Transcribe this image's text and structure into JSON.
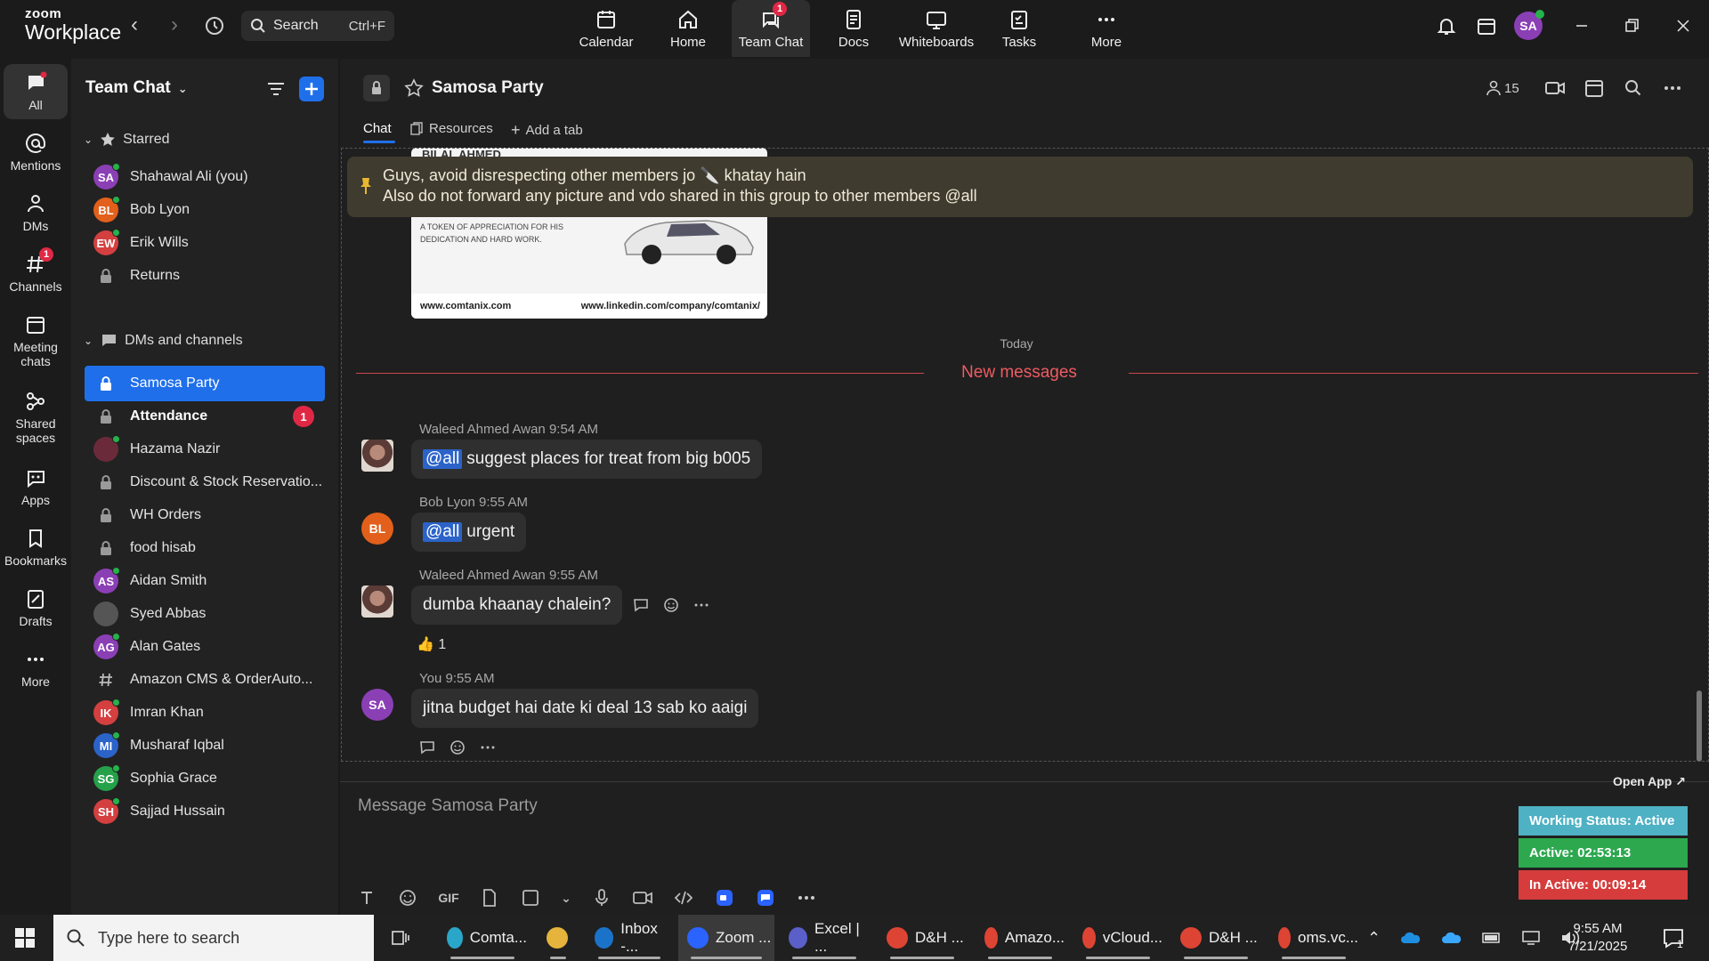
{
  "app": {
    "logo_top": "zoom",
    "logo_bottom": "Workplace"
  },
  "search": {
    "label": "Search",
    "shortcut": "Ctrl+F"
  },
  "topnav": [
    {
      "label": "Calendar",
      "icon": "calendar-icon"
    },
    {
      "label": "Home",
      "icon": "home-icon"
    },
    {
      "label": "Team Chat",
      "icon": "chat-icon",
      "badge": "1"
    },
    {
      "label": "Docs",
      "icon": "docs-icon"
    },
    {
      "label": "Whiteboards",
      "icon": "whiteboard-icon"
    },
    {
      "label": "Tasks",
      "icon": "tasks-icon"
    },
    {
      "label": "More",
      "icon": "more-icon"
    }
  ],
  "user": {
    "initials": "SA"
  },
  "rail": [
    {
      "label": "All"
    },
    {
      "label": "Mentions"
    },
    {
      "label": "DMs"
    },
    {
      "label": "Channels",
      "badge": "1"
    },
    {
      "label": "Meeting chats"
    },
    {
      "label": "Shared spaces"
    },
    {
      "label": "Apps"
    },
    {
      "label": "Bookmarks"
    },
    {
      "label": "Drafts"
    },
    {
      "label": "More"
    }
  ],
  "panel": {
    "title": "Team Chat",
    "starred_label": "Starred",
    "dms_label": "DMs and channels",
    "starred": [
      {
        "name": "Shahawal Ali (you)",
        "initials": "SA",
        "color": "#8b3fb5",
        "online": true
      },
      {
        "name": "Bob Lyon",
        "initials": "BL",
        "color": "#e2601b",
        "online": true
      },
      {
        "name": "Erik Wills",
        "initials": "EW",
        "color": "#d43f3f",
        "online": true
      },
      {
        "name": "Returns",
        "lock": true
      }
    ],
    "channels": [
      {
        "name": "Samosa Party",
        "lock": true,
        "selected": true
      },
      {
        "name": "Attendance",
        "lock": true,
        "bold": true,
        "count": "1"
      },
      {
        "name": "Hazama Nazir",
        "initials": "",
        "color": "#6b2a3a",
        "online": true
      },
      {
        "name": "Discount & Stock Reservatio...",
        "lock": true
      },
      {
        "name": "WH Orders",
        "lock": true
      },
      {
        "name": "food hisab",
        "lock": true
      },
      {
        "name": "Aidan Smith",
        "initials": "AS",
        "color": "#8b3fb5",
        "online": true
      },
      {
        "name": "Syed Abbas",
        "initials": "",
        "color": "#555",
        "online": false
      },
      {
        "name": "Alan Gates",
        "initials": "AG",
        "color": "#8b3fb5",
        "online": true
      },
      {
        "name": "Amazon CMS & OrderAuto...",
        "hash": true
      },
      {
        "name": "Imran Khan",
        "initials": "IK",
        "color": "#d43f3f",
        "online": true
      },
      {
        "name": "Musharaf Iqbal",
        "initials": "MI",
        "color": "#2b63c9",
        "online": true
      },
      {
        "name": "Sophia Grace",
        "initials": "SG",
        "color": "#25a14a",
        "online": true
      },
      {
        "name": "Sajjad Hussain",
        "initials": "SH",
        "color": "#d43f3f",
        "online": true
      }
    ]
  },
  "chat": {
    "title": "Samosa Party",
    "members": "15",
    "tabs": [
      "Chat",
      "Resources",
      "Add a tab"
    ],
    "pinned_line1": "Guys, avoid disrespecting other members jo 🔪 khatay hain",
    "pinned_line2": "Also do not forward any picture and vdo shared in this group to other members @all",
    "image": {
      "header": "BILAL AHMED",
      "caption1": "A TOKEN OF APPRECIATION FOR HIS",
      "caption2": "DEDICATION AND HARD WORK.",
      "site": "www.comtanix.com",
      "linkedin": "www.linkedin.com/company/comtanix/"
    },
    "date_divider": "Today",
    "new_messages": "New messages",
    "messages": [
      {
        "sender": "Waleed Ahmed Awan",
        "time": "9:54 AM",
        "mention": "@all",
        "text": "suggest places for treat from big b005"
      },
      {
        "sender": "Bob Lyon",
        "time": "9:55 AM",
        "mention": "@all",
        "text": "urgent",
        "initials": "BL"
      },
      {
        "sender": "Waleed Ahmed Awan",
        "time": "9:55 AM",
        "mention": "",
        "text": "dumba khaanay chalein?",
        "reaction": "👍 1"
      },
      {
        "sender": "You",
        "time": "9:55 AM",
        "mention": "",
        "text": "jitna budget hai date ki deal 13 sab ko aaigi",
        "initials": "SA"
      }
    ],
    "composer_placeholder": "Message Samosa Party"
  },
  "widget": {
    "open_app": "Open App ↗",
    "status": "Working Status: Active",
    "active": "Active: 02:53:13",
    "inactive": "In Active: 00:09:14"
  },
  "taskbar": {
    "search_placeholder": "Type here to search",
    "apps": [
      {
        "label": "Comta...",
        "color": "#2aa6c9"
      },
      {
        "label": "",
        "color": "#e6b43c"
      },
      {
        "label": "Inbox -...",
        "color": "#1a73c9"
      },
      {
        "label": "Zoom ...",
        "color": "#2b63ff"
      },
      {
        "label": "Excel | ...",
        "color": "#5a5fc9"
      },
      {
        "label": "D&H ...",
        "color": "#dd4433"
      },
      {
        "label": "Amazo...",
        "color": "#dd4433"
      },
      {
        "label": "vCloud...",
        "color": "#dd4433"
      },
      {
        "label": "D&H ...",
        "color": "#dd4433"
      },
      {
        "label": "oms.vc...",
        "color": "#dd4433"
      }
    ],
    "time": "9:55 AM",
    "date": "7/21/2025"
  }
}
